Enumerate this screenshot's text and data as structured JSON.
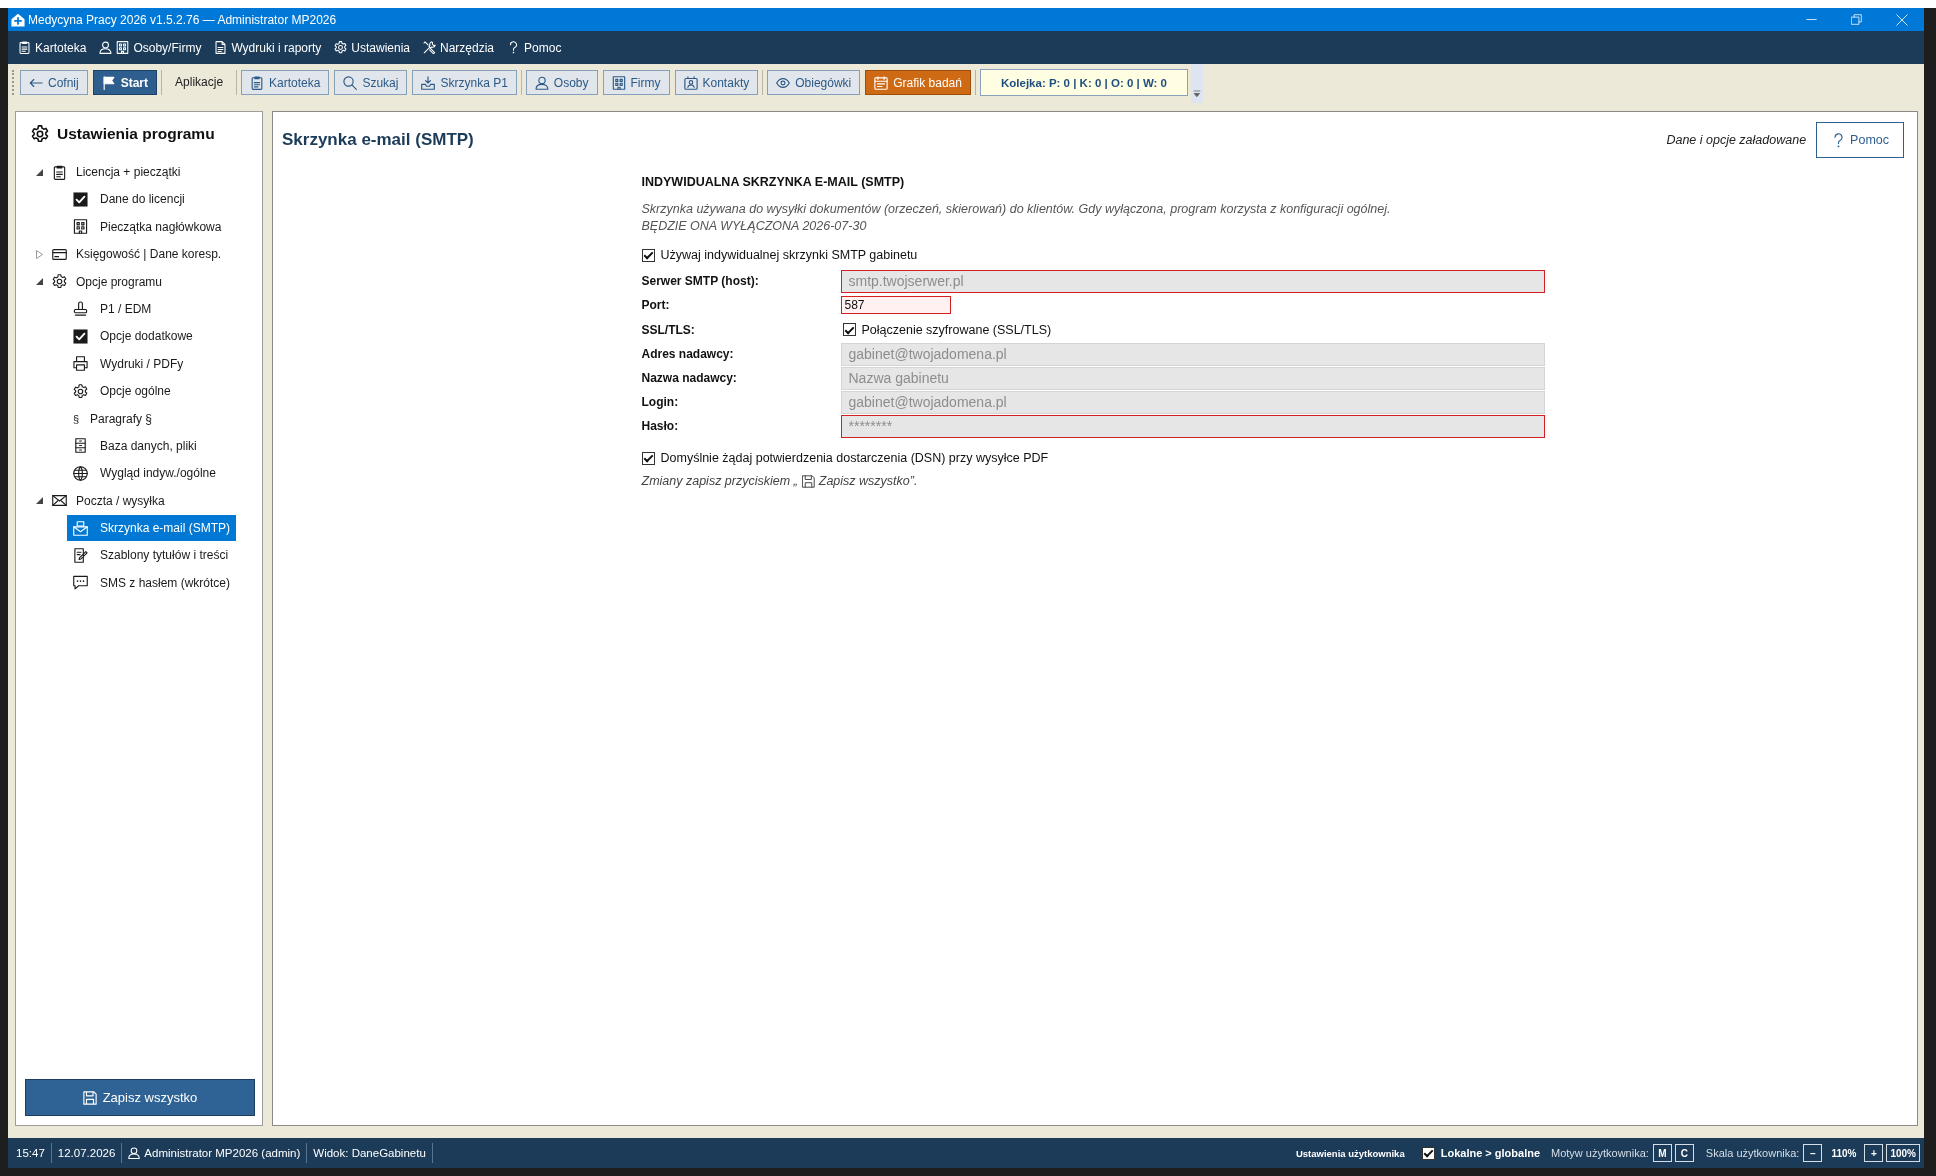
{
  "window": {
    "title": "Medycyna Pracy 2026 v1.5.2.76 — Administrator MP2026"
  },
  "menu": [
    "Kartoteka",
    "Osoby/Firmy",
    "Wydruki i raporty",
    "Ustawienia",
    "Narzędzia",
    "Pomoc"
  ],
  "toolbar": {
    "groups": [
      [
        {
          "kind": "button",
          "label": "Cofnij"
        },
        {
          "kind": "primary",
          "label": "Start"
        }
      ],
      [
        {
          "kind": "label",
          "label": "Aplikacje"
        }
      ],
      [
        {
          "kind": "button",
          "label": "Kartoteka"
        },
        {
          "kind": "button",
          "label": "Szukaj"
        },
        {
          "kind": "button",
          "label": "Skrzynka P1"
        }
      ],
      [
        {
          "kind": "button",
          "label": "Osoby"
        },
        {
          "kind": "button",
          "label": "Firmy"
        },
        {
          "kind": "button",
          "label": "Kontakty"
        }
      ],
      [
        {
          "kind": "button",
          "label": "Obiegówki"
        },
        {
          "kind": "accent",
          "label": "Grafik badań"
        }
      ],
      [
        {
          "kind": "counter",
          "label": "Kolejka: P: 0 | K: 0 | O: 0 | W: 0"
        }
      ]
    ]
  },
  "sidebar": {
    "title": "Ustawienia programu",
    "tree": [
      {
        "label": "Licencja + pieczątki",
        "selected": false,
        "expanded": true,
        "children": [
          {
            "label": "Dane do licencji",
            "selected": false
          },
          {
            "label": "Pieczątka nagłówkowa",
            "selected": false
          }
        ]
      },
      {
        "label": "Księgowość | Dane koresp.",
        "selected": false,
        "expanded": false
      },
      {
        "label": "Opcje programu",
        "selected": false,
        "expanded": true,
        "children": [
          {
            "label": "P1 / EDM",
            "selected": false
          },
          {
            "label": "Opcje dodatkowe",
            "selected": false
          },
          {
            "label": "Wydruki / PDFy",
            "selected": false
          },
          {
            "label": "Opcje ogólne",
            "selected": false
          },
          {
            "label": "Paragrafy §",
            "glyph": "§",
            "selected": false
          },
          {
            "label": "Baza danych, pliki",
            "selected": false
          },
          {
            "label": "Wygląd indyw./ogólne",
            "selected": false
          }
        ]
      },
      {
        "label": "Poczta / wysyłka",
        "selected": false,
        "expanded": true,
        "children": [
          {
            "label": "Skrzynka e-mail (SMTP)",
            "selected": true
          },
          {
            "label": "Szablony tytułów i treści",
            "selected": false
          },
          {
            "label": "SMS z hasłem (wkrótce)",
            "selected": false
          }
        ]
      }
    ],
    "save_button": "Zapisz wszystko"
  },
  "page": {
    "title": "Skrzynka e-mail (SMTP)",
    "status": "Dane i opcje załadowane",
    "help_button": "Pomoc"
  },
  "form": {
    "heading": "INDYWIDUALNA SKRZYNKA E-MAIL (SMTP)",
    "description": [
      "Skrzynka używana do wysyłki dokumentów (orzeczeń, skierowań) do klientów. Gdy wyłączona, program korzysta z konfiguracji ogólnej.",
      "BĘDZIE ONA WYŁĄCZONA 2026-07-30"
    ],
    "use_own": {
      "label": "Używaj indywidualnej skrzynki SMTP gabinetu",
      "checked": true
    },
    "fields": [
      {
        "kind": "text",
        "label": "Serwer SMTP (host):",
        "placeholder": "smtp.twojserwer.pl",
        "invalid": true
      },
      {
        "kind": "number",
        "label": "Port:",
        "value": "587",
        "invalid": true
      },
      {
        "kind": "checkbox",
        "label": "SSL/TLS:",
        "option": "Połączenie szyfrowane (SSL/TLS)",
        "checked": true
      },
      {
        "kind": "text",
        "label": "Adres nadawcy:",
        "placeholder": "gabinet@twojadomena.pl",
        "invalid": false
      },
      {
        "kind": "text",
        "label": "Nazwa nadawcy:",
        "placeholder": "Nazwa gabinetu",
        "invalid": false
      },
      {
        "kind": "text",
        "label": "Login:",
        "placeholder": "gabinet@twojadomena.pl",
        "invalid": false
      },
      {
        "kind": "password",
        "label": "Hasło:",
        "placeholder": "********",
        "invalid": true
      }
    ],
    "dsn": {
      "label": "Domyślnie żądaj potwierdzenia dostarczenia (DSN) przy wysyłce PDF",
      "checked": true
    },
    "save_hint": {
      "before": "Zmiany zapisz przyciskiem „",
      "after": "Zapisz wszystko”."
    }
  },
  "status_bar": {
    "time": "15:47",
    "date": "12.07.2026",
    "user": "Administrator MP2026 (admin)",
    "view": "Widok: DaneGabinetu",
    "user_settings": "Ustawienia użytkownika",
    "local_over_global": {
      "label": "Lokalne > globalne",
      "checked": true
    },
    "theme_label": "Motyw użytkownika:",
    "theme_buttons": [
      "M",
      "C"
    ],
    "scale_label": "Skala użytkownika:",
    "scale_minus": "–",
    "scale_value": "110%",
    "scale_plus": "+",
    "scale_reset": "100%"
  }
}
